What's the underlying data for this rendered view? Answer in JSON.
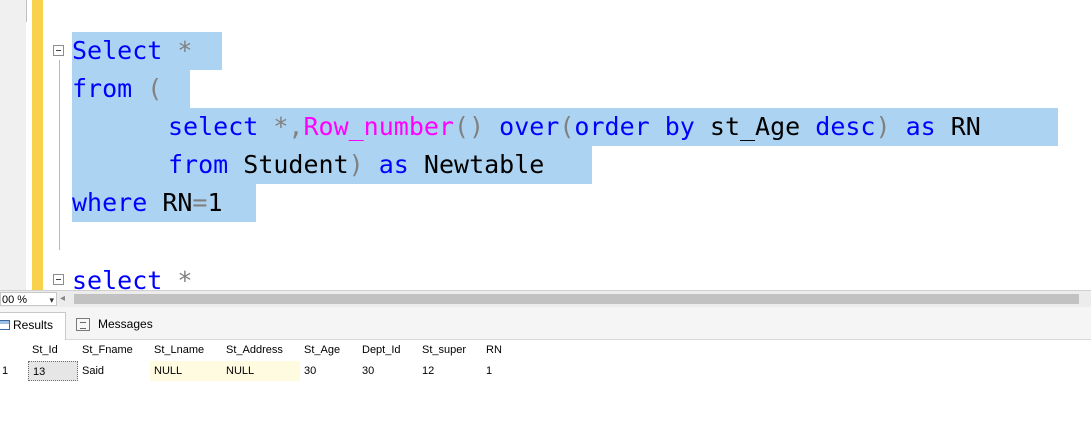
{
  "editor": {
    "lines": [
      {
        "parts": [
          {
            "text": "Select",
            "cls": "kw"
          },
          {
            "text": " *",
            "cls": "op"
          }
        ]
      },
      {
        "parts": [
          {
            "text": "from",
            "cls": "kw"
          },
          {
            "text": " (",
            "cls": "op"
          }
        ]
      },
      {
        "parts": [
          {
            "text": "select",
            "cls": "kw"
          },
          {
            "text": " *,",
            "cls": "op"
          },
          {
            "text": "Row_number",
            "cls": "fn"
          },
          {
            "text": "()",
            "cls": "op"
          },
          {
            "text": " over",
            "cls": "kw"
          },
          {
            "text": "(",
            "cls": "op"
          },
          {
            "text": "order by",
            "cls": "kw"
          },
          {
            "text": " st_Age ",
            "cls": "id"
          },
          {
            "text": "desc",
            "cls": "kw"
          },
          {
            "text": ")",
            "cls": "op"
          },
          {
            "text": " as",
            "cls": "kw"
          },
          {
            "text": " RN",
            "cls": "id"
          }
        ]
      },
      {
        "parts": [
          {
            "text": "from",
            "cls": "kw"
          },
          {
            "text": " Student",
            "cls": "id"
          },
          {
            "text": ")",
            "cls": "op"
          },
          {
            "text": " as",
            "cls": "kw"
          },
          {
            "text": " Newtable",
            "cls": "id"
          }
        ]
      },
      {
        "parts": [
          {
            "text": "where",
            "cls": "kw"
          },
          {
            "text": " RN",
            "cls": "id"
          },
          {
            "text": "=",
            "cls": "op"
          },
          {
            "text": "1",
            "cls": "id"
          }
        ]
      },
      {
        "parts": [
          {
            "text": "select",
            "cls": "kw"
          },
          {
            "text": " *",
            "cls": "op"
          }
        ]
      }
    ]
  },
  "zoom": {
    "value": "00 %"
  },
  "tabs": {
    "results_label": "Results",
    "messages_label": "Messages"
  },
  "grid": {
    "columns": [
      "St_Id",
      "St_Fname",
      "St_Lname",
      "St_Address",
      "St_Age",
      "Dept_Id",
      "St_super",
      "RN"
    ],
    "rows": [
      {
        "row_number": "1",
        "cells": [
          "13",
          "Said",
          "NULL",
          "NULL",
          "30",
          "30",
          "12",
          "1"
        ]
      }
    ]
  },
  "colors": {
    "keyword": "#0000ff",
    "function": "#ff00ff",
    "operator": "#808080",
    "selection": "#acd4f2",
    "change_bar": "#f7d24a"
  }
}
